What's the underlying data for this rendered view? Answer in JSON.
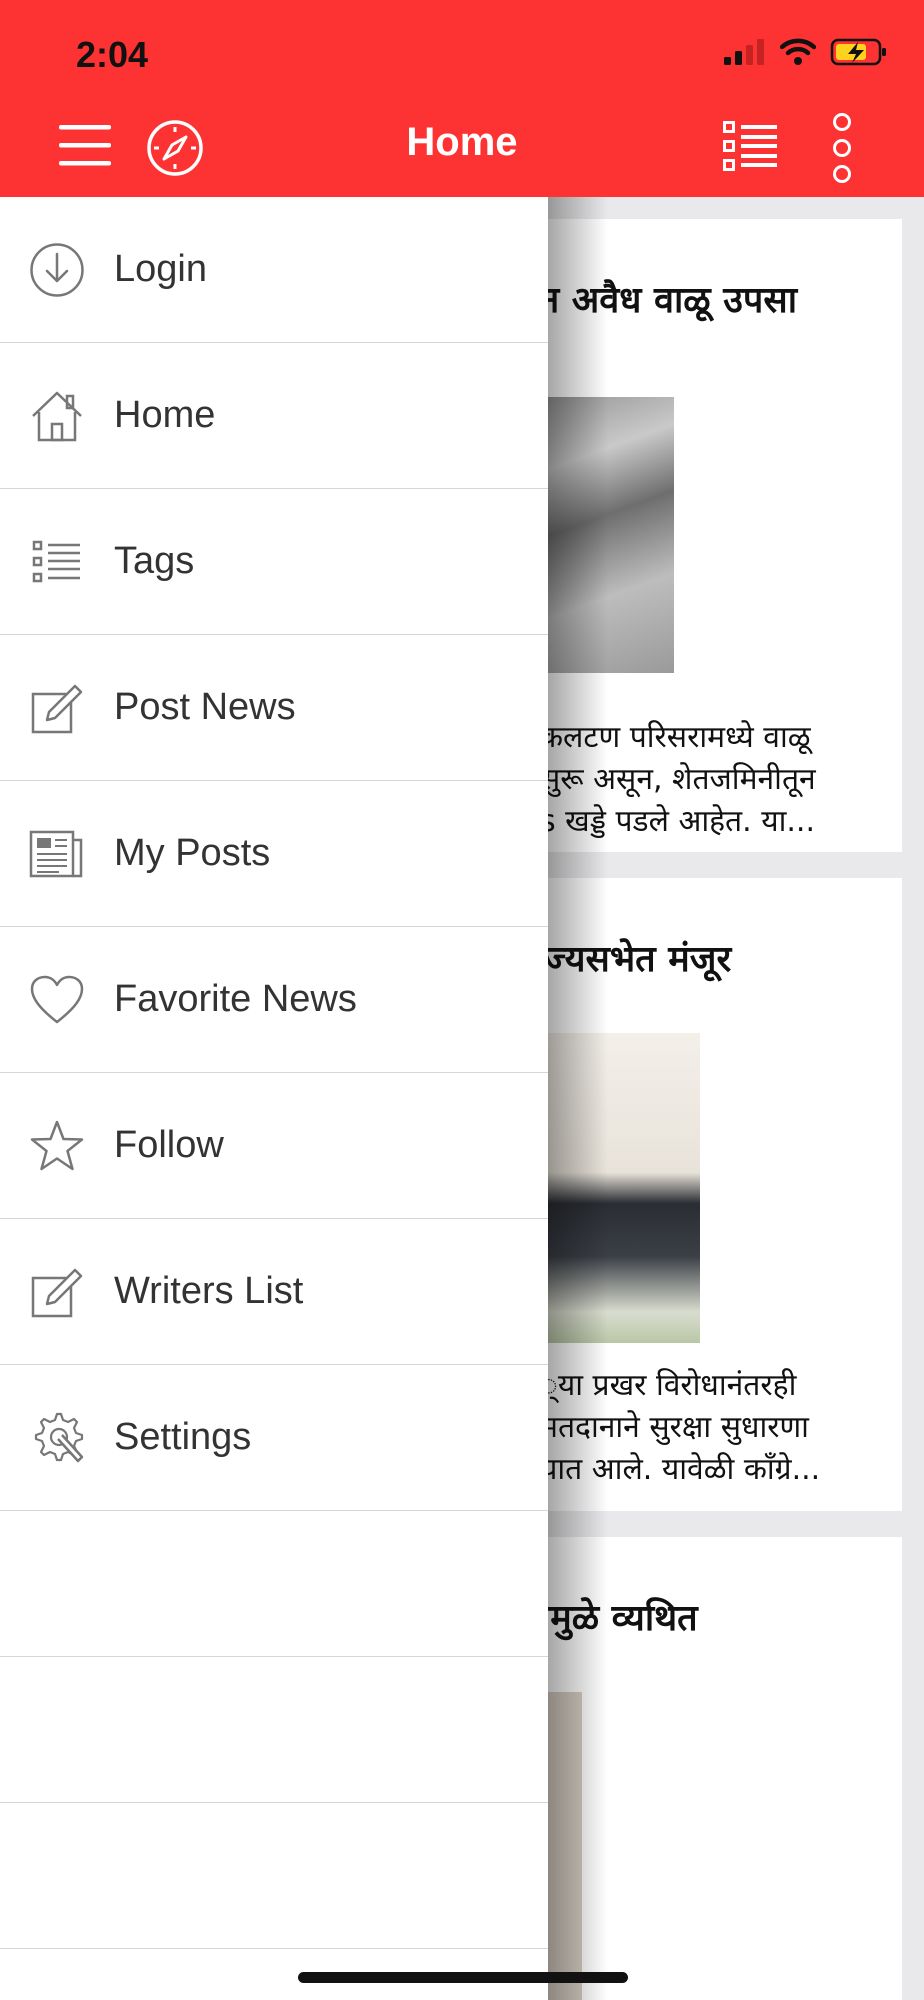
{
  "status": {
    "time": "2:04"
  },
  "appbar": {
    "title": "Home"
  },
  "drawer": {
    "items": [
      {
        "label": "Login",
        "icon": "login-icon"
      },
      {
        "label": "Home",
        "icon": "home-icon"
      },
      {
        "label": "Tags",
        "icon": "tags-list-icon"
      },
      {
        "label": "Post News",
        "icon": "edit-icon"
      },
      {
        "label": "My Posts",
        "icon": "newspaper-icon"
      },
      {
        "label": "Favorite News",
        "icon": "heart-icon"
      },
      {
        "label": "Follow",
        "icon": "star-icon"
      },
      {
        "label": "Writers List",
        "icon": "edit-icon"
      },
      {
        "label": "Settings",
        "icon": "settings-icon"
      },
      {
        "label": ""
      },
      {
        "label": ""
      },
      {
        "label": ""
      }
    ]
  },
  "feed": {
    "cards": [
      {
        "title": "डून अवैध वाळू उपसा",
        "excerpt": [
          "कलटण परिसरामध्ये वाळू",
          "सुरू असून, शेतजमिनीतून",
          "s खड्डे पडले आहेत. या..."
        ]
      },
      {
        "title": "राज्यसभेत मंजूर",
        "excerpt": [
          "्या प्रखर विरोधानंतरही",
          "मतदानाने सुरक्षा सुधारणा",
          "यात आले. यावेळी काँग्रे..."
        ]
      },
      {
        "title": "यांमुळे व्यथित",
        "excerpt": []
      }
    ]
  },
  "colors": {
    "accent": "#fd3232",
    "drawer_bg": "#ffffff",
    "text": "#333333"
  }
}
